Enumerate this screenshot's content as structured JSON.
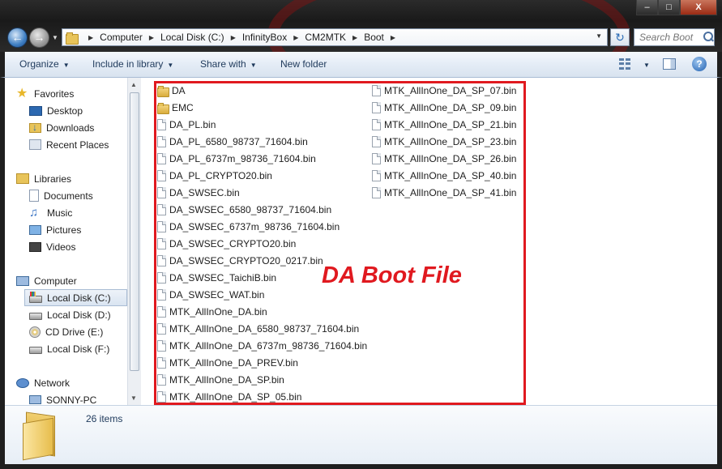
{
  "window": {
    "controls": {
      "minimize": "–",
      "maximize": "□",
      "close": "X"
    }
  },
  "address": {
    "crumbs": [
      "Computer",
      "Local Disk (C:)",
      "InfinityBox",
      "CM2MTK",
      "Boot"
    ]
  },
  "search": {
    "placeholder": "Search Boot"
  },
  "toolbar": {
    "organize": "Organize",
    "include_in_library": "Include in library",
    "share_with": "Share with",
    "new_folder": "New folder"
  },
  "nav": {
    "favorites": "Favorites",
    "desktop": "Desktop",
    "downloads": "Downloads",
    "recent_places": "Recent Places",
    "libraries": "Libraries",
    "documents": "Documents",
    "music": "Music",
    "pictures": "Pictures",
    "videos": "Videos",
    "computer": "Computer",
    "disk_c": "Local Disk (C:)",
    "disk_d": "Local Disk (D:)",
    "cd_drive": "CD Drive (E:)",
    "disk_f": "Local Disk (F:)",
    "network": "Network",
    "sonny_pc": "SONNY-PC"
  },
  "files": {
    "col1": [
      {
        "name": "DA",
        "type": "folder"
      },
      {
        "name": "EMC",
        "type": "folder"
      },
      {
        "name": "DA_PL.bin",
        "type": "file"
      },
      {
        "name": "DA_PL_6580_98737_71604.bin",
        "type": "file"
      },
      {
        "name": "DA_PL_6737m_98736_71604.bin",
        "type": "file"
      },
      {
        "name": "DA_PL_CRYPTO20.bin",
        "type": "file"
      },
      {
        "name": "DA_SWSEC.bin",
        "type": "file"
      },
      {
        "name": "DA_SWSEC_6580_98737_71604.bin",
        "type": "file"
      },
      {
        "name": "DA_SWSEC_6737m_98736_71604.bin",
        "type": "file"
      },
      {
        "name": "DA_SWSEC_CRYPTO20.bin",
        "type": "file"
      },
      {
        "name": "DA_SWSEC_CRYPTO20_0217.bin",
        "type": "file"
      },
      {
        "name": "DA_SWSEC_TaichiB.bin",
        "type": "file"
      },
      {
        "name": "DA_SWSEC_WAT.bin",
        "type": "file"
      },
      {
        "name": "MTK_AllInOne_DA.bin",
        "type": "file"
      },
      {
        "name": "MTK_AllInOne_DA_6580_98737_71604.bin",
        "type": "file"
      },
      {
        "name": "MTK_AllInOne_DA_6737m_98736_71604.bin",
        "type": "file"
      },
      {
        "name": "MTK_AllInOne_DA_PREV.bin",
        "type": "file"
      },
      {
        "name": "MTK_AllInOne_DA_SP.bin",
        "type": "file"
      },
      {
        "name": "MTK_AllInOne_DA_SP_05.bin",
        "type": "file"
      }
    ],
    "col2": [
      {
        "name": "MTK_AllInOne_DA_SP_07.bin",
        "type": "file"
      },
      {
        "name": "MTK_AllInOne_DA_SP_09.bin",
        "type": "file"
      },
      {
        "name": "MTK_AllInOne_DA_SP_21.bin",
        "type": "file"
      },
      {
        "name": "MTK_AllInOne_DA_SP_23.bin",
        "type": "file"
      },
      {
        "name": "MTK_AllInOne_DA_SP_26.bin",
        "type": "file"
      },
      {
        "name": "MTK_AllInOne_DA_SP_40.bin",
        "type": "file"
      },
      {
        "name": "MTK_AllInOne_DA_SP_41.bin",
        "type": "file"
      }
    ]
  },
  "annotation": "DA Boot File",
  "details": {
    "item_count": "26 items"
  },
  "colors": {
    "annotation_red": "#e0191f",
    "toolbar_text": "#1e395b"
  }
}
